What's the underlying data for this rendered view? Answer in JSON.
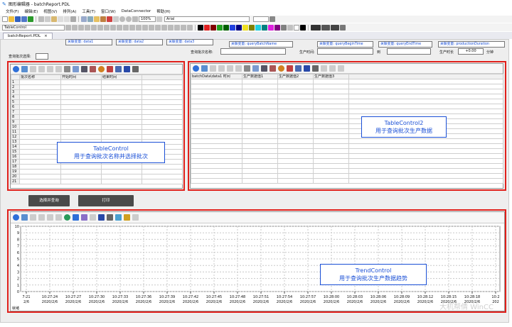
{
  "app": {
    "title": "图形编辑器 - batchReport.PDL",
    "icon_name": "graphics-editor-icon"
  },
  "menu": [
    "文件(F)",
    "编辑(E)",
    "视图(V)",
    "排列(A)",
    "工具(T)",
    "窗口(W)",
    "DataConnector",
    "帮助(H)"
  ],
  "toolbar": {
    "zoom": "100%",
    "font": "Arial",
    "control_combo": "TableControl"
  },
  "doc_tab": {
    "label": "batchReport.PDL",
    "close": "×"
  },
  "tags": {
    "top": [
      "关联变量: data1",
      "关联变量: data2",
      "关联变量: data3"
    ],
    "query_batch_name": "关联变量: queryBatchName",
    "query_begin": "关联变量: queryBeginTime",
    "query_end": "关联变量: queryEndTime",
    "production_duration": "关联变量: productionDuration"
  },
  "fields": {
    "batch_select": "查询批次选择:",
    "batch_name": "查询批次名称:",
    "produce_time": "生产时间:",
    "to": "到",
    "produce_duration": "生产时长",
    "duration_value": "+0.00",
    "minutes": "分钟"
  },
  "table1": {
    "headers": [
      "批次名称",
      "开始时间",
      "结束时间"
    ],
    "row_numbers": [
      "1",
      "2",
      "3",
      "4",
      "5",
      "6",
      "7",
      "8",
      "9",
      "10",
      "11",
      "12",
      "13",
      "14",
      "15",
      "16",
      "17",
      "18",
      "19",
      "20",
      "21"
    ]
  },
  "table2": {
    "headers": [
      "batchData\\data1 时间",
      "生产数据值1",
      "生产数据值2",
      "生产数据值3"
    ]
  },
  "notes": {
    "table1_name": "TableControl",
    "table1_desc": "用于查询批次名称并选择批次",
    "table2_name": "TableControl2",
    "table2_desc": "用于查询批次生产数据",
    "trend_name": "TrendControl",
    "trend_desc": "用于查询批次生产数据趋势"
  },
  "buttons": {
    "select_query": "选择并查询",
    "print": "打印"
  },
  "trend": {
    "y_ticks": [
      "10",
      "9",
      "8",
      "7",
      "6",
      "5",
      "4",
      "3",
      "2",
      "1",
      "0"
    ],
    "x_times": [
      "7:21",
      "10:27:24",
      "10:27:27",
      "10:27:30",
      "10:27:33",
      "10:27:36",
      "10:27:39",
      "10:27:42",
      "10:27:45",
      "10:27:48",
      "10:27:51",
      "10:27:54",
      "10:27:57",
      "10:28:00",
      "10:28:03",
      "10:28:06",
      "10:28:09",
      "10:28:12",
      "10:28:15",
      "10:28:18",
      "10:2"
    ],
    "x_dates": [
      "2/6",
      "2020/2/6",
      "2020/2/6",
      "2020/2/6",
      "2020/2/6",
      "2020/2/6",
      "2020/2/6",
      "2020/2/6",
      "2020/2/6",
      "2020/2/6",
      "2020/2/6",
      "2020/2/6",
      "2020/2/6",
      "2020/2/6",
      "2020/2/6",
      "2020/2/6",
      "2020/2/6",
      "2020/2/6",
      "2020/2/6",
      "2020/2/6",
      "202"
    ],
    "status": "就绪"
  },
  "watermark": "大机帮倩 WinCC",
  "colors": {
    "accent_red": "#e0201b",
    "label_blue": "#1a4fd6",
    "button_dark": "#4a4a4a"
  }
}
